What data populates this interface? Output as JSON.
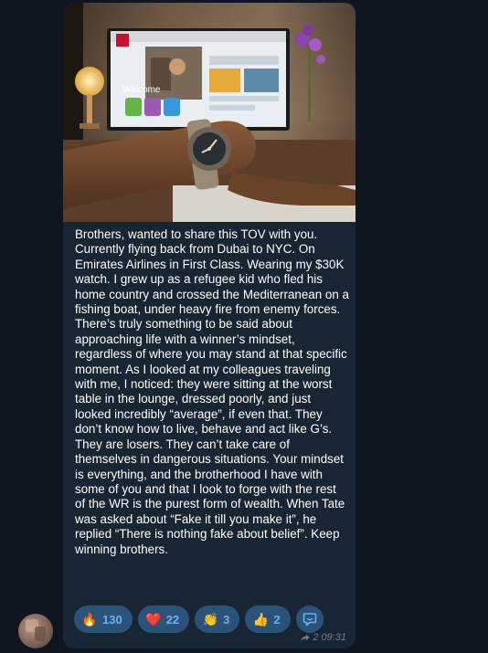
{
  "message": {
    "text": "Brothers, wanted to share this TOV with you. Currently flying back from Dubai to NYC. On Emirates Airlines in First Class. Wearing my $30K watch. I grew up as a refugee kid who fled his home country and crossed the Mediterranean on a fishing boat, under heavy fire from enemy forces. There’s truly something to be said about approaching life with a winner’s mindset, regardless of where you may stand at that specific moment. As I looked at my colleagues traveling with me, I noticed: they were sitting at the worst table in the lounge, dressed poorly, and just looked incredibly “average”, if even that. They don’t know how to live, behave and act like G’s. They are losers. They can’t take care of themselves in dangerous situations. Your mindset is everything, and the brotherhood I have with some of you and that I look to forge with the rest of the WR is the purest form of wealth. When Tate was asked about “Fake it till you make it”, he replied “There is nothing fake about belief”. Keep winning brothers.",
    "photo_screen_text": "Welcome",
    "reactions": [
      {
        "emoji": "🔥",
        "icon": "fire-icon",
        "count": "130"
      },
      {
        "emoji": "❤️",
        "icon": "heart-icon",
        "count": "22"
      },
      {
        "emoji": "👏",
        "icon": "clap-icon",
        "count": "3"
      },
      {
        "emoji": "👍",
        "icon": "thumbs-up-icon",
        "count": "2"
      }
    ],
    "forward_count": "2",
    "time": "09:31"
  },
  "colors": {
    "background": "#0e1621",
    "bubble": "#182533",
    "reaction_pill": "#2b5278",
    "reaction_count": "#6ab3f3",
    "meta_text": "#6d7f8f"
  }
}
